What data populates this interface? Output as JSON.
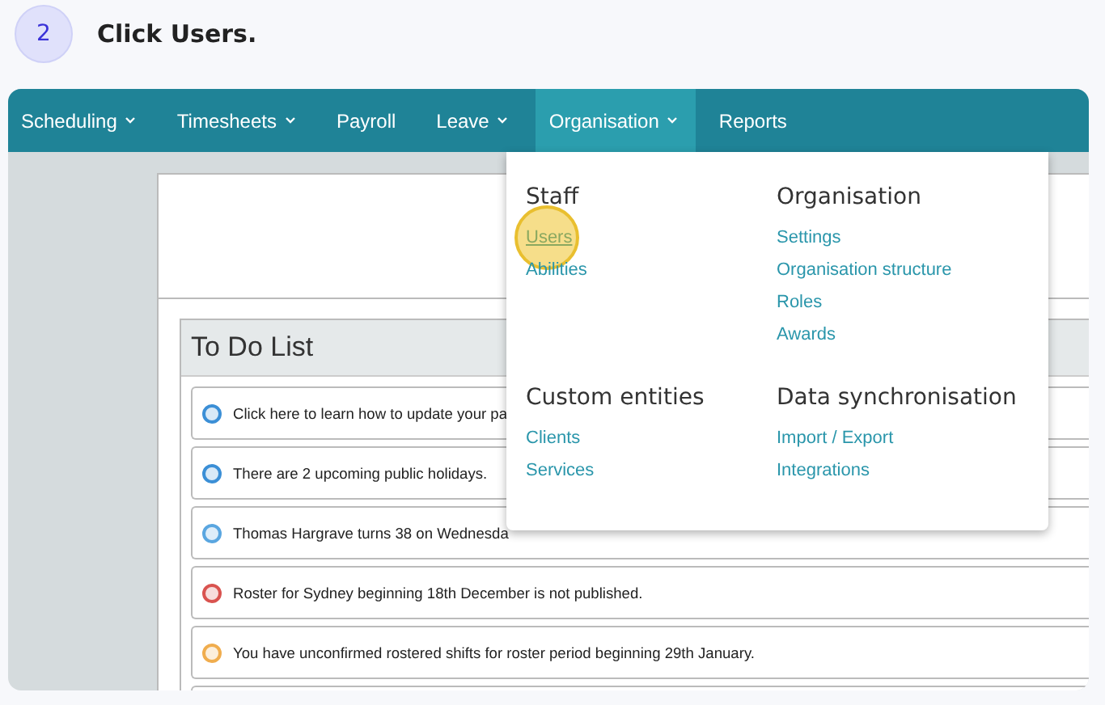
{
  "step": {
    "number": "2",
    "instruction": "Click Users."
  },
  "nav": [
    {
      "label": "Scheduling",
      "has_menu": true,
      "selected": false
    },
    {
      "label": "Timesheets",
      "has_menu": true,
      "selected": false
    },
    {
      "label": "Payroll",
      "has_menu": false,
      "selected": false
    },
    {
      "label": "Leave",
      "has_menu": true,
      "selected": false
    },
    {
      "label": "Organisation",
      "has_menu": true,
      "selected": true
    },
    {
      "label": "Reports",
      "has_menu": false,
      "selected": false
    }
  ],
  "todo": {
    "title": "To Do List",
    "items": [
      {
        "text": "Click here to learn how to update your pa",
        "color": "#3b8fd6"
      },
      {
        "text": "There are 2 upcoming public holidays.",
        "color": "#3b8fd6"
      },
      {
        "text": "Thomas Hargrave turns 38 on Wednesda",
        "color": "#5aa6e0"
      },
      {
        "text": "Roster for Sydney beginning 18th December is not published.",
        "color": "#d9534f"
      },
      {
        "text": "You have unconfirmed rostered shifts for roster period beginning 29th January.",
        "color": "#f0ad4e"
      }
    ]
  },
  "menu": {
    "sections": [
      {
        "heading": "Staff",
        "links": [
          {
            "label": "Users",
            "highlighted": true
          },
          {
            "label": "Abilities",
            "highlighted": false
          }
        ]
      },
      {
        "heading": "Organisation",
        "links": [
          {
            "label": "Settings",
            "highlighted": false
          },
          {
            "label": "Organisation structure",
            "highlighted": false
          },
          {
            "label": "Roles",
            "highlighted": false
          },
          {
            "label": "Awards",
            "highlighted": false
          }
        ]
      },
      {
        "heading": "Custom entities",
        "links": [
          {
            "label": "Clients",
            "highlighted": false
          },
          {
            "label": "Services",
            "highlighted": false
          }
        ]
      },
      {
        "heading": "Data synchronisation",
        "links": [
          {
            "label": "Import / Export",
            "highlighted": false
          },
          {
            "label": "Integrations",
            "highlighted": false
          }
        ]
      }
    ]
  }
}
